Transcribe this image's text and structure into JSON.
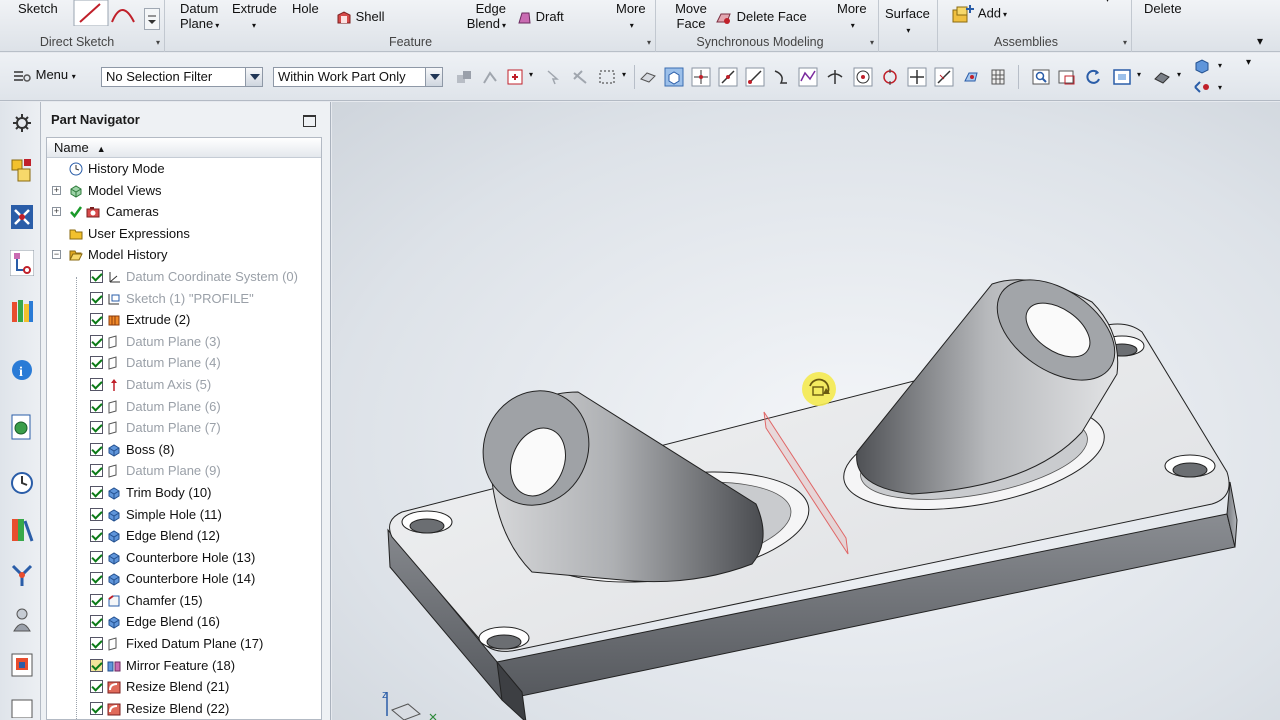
{
  "ribbon": {
    "direct_sketch": {
      "sketch_label": "Sketch",
      "group_label": "Direct Sketch"
    },
    "feature": {
      "datum_plane_label": "Datum Plane",
      "extrude_label": "Extrude",
      "hole_label": "Hole",
      "shell_label": "Shell",
      "edge_blend_label": "Edge Blend",
      "draft_label": "Draft",
      "more_label": "More",
      "group_label": "Feature"
    },
    "synchronous": {
      "move_face_label": "Move Face",
      "delete_face_label": "Delete Face",
      "more_label": "More",
      "group_label": "Synchronous Modeling"
    },
    "surface": {
      "surface_label": "Surface"
    },
    "assemblies": {
      "add_label": "Add",
      "group_label": "Assemblies"
    },
    "delete_label": "Delete"
  },
  "toolbar": {
    "menu_label": "Menu",
    "selection_filter": "No Selection Filter",
    "scope_filter": "Within Work Part Only"
  },
  "navigator": {
    "title": "Part Navigator",
    "column_header": "Name",
    "top_items": [
      {
        "label": "History Mode"
      },
      {
        "label": "Model Views"
      },
      {
        "label": "Cameras"
      },
      {
        "label": "User Expressions"
      },
      {
        "label": "Model History"
      }
    ],
    "history": [
      {
        "label": "Datum Coordinate System (0)",
        "greyed": true
      },
      {
        "label": "Sketch (1) \"PROFILE\"",
        "greyed": true
      },
      {
        "label": "Extrude (2)",
        "greyed": false
      },
      {
        "label": "Datum Plane (3)",
        "greyed": true
      },
      {
        "label": "Datum Plane (4)",
        "greyed": true
      },
      {
        "label": "Datum Axis (5)",
        "greyed": true
      },
      {
        "label": "Datum Plane (6)",
        "greyed": true
      },
      {
        "label": "Datum Plane (7)",
        "greyed": true
      },
      {
        "label": "Boss (8)",
        "greyed": false
      },
      {
        "label": "Datum Plane (9)",
        "greyed": true
      },
      {
        "label": "Trim Body (10)",
        "greyed": false
      },
      {
        "label": "Simple Hole (11)",
        "greyed": false
      },
      {
        "label": "Edge Blend (12)",
        "greyed": false
      },
      {
        "label": "Counterbore Hole (13)",
        "greyed": false
      },
      {
        "label": "Counterbore Hole (14)",
        "greyed": false
      },
      {
        "label": "Chamfer (15)",
        "greyed": false
      },
      {
        "label": "Edge Blend (16)",
        "greyed": false
      },
      {
        "label": "Fixed Datum Plane (17)",
        "greyed": false
      },
      {
        "label": "Mirror Feature (18)",
        "greyed": false
      },
      {
        "label": "Resize Blend (21)",
        "greyed": false
      },
      {
        "label": "Resize Blend (22)",
        "greyed": false
      }
    ]
  },
  "colors": {
    "accent": "#2a5da8",
    "check": "#0a7a16",
    "model_grey": "#8c8f94"
  }
}
